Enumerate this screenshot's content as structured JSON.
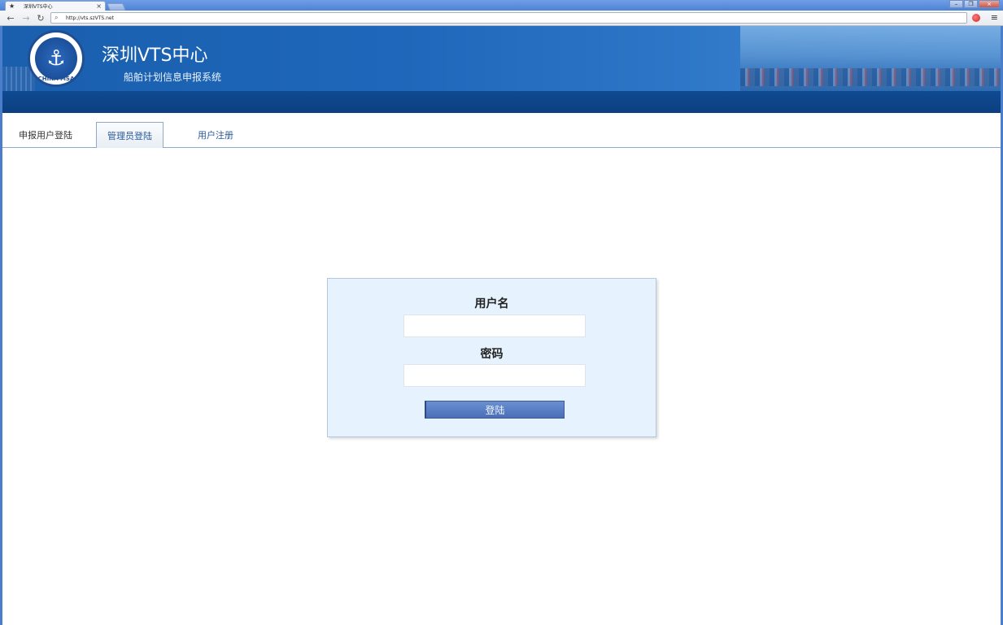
{
  "browser": {
    "tab_title": "深圳VTS中心",
    "tab_close": "×",
    "url": "http://vts.szVTS.net",
    "icons": {
      "star": "★",
      "back": "←",
      "forward": "→",
      "reload": "↻",
      "search": "⌕",
      "menu": "≡"
    },
    "window_controls": {
      "minimize": "–",
      "restore": "❐",
      "close": "×"
    }
  },
  "header": {
    "title": "深圳VTS中心",
    "subtitle": "船舶计划信息申报系统",
    "logo_text": "CHINA MSA",
    "logo_symbol": "⚓"
  },
  "nav": {
    "tabs": [
      {
        "label": "申报用户登陆",
        "active": false
      },
      {
        "label": "管理员登陆",
        "active": true
      },
      {
        "label": "用户注册",
        "active": false
      }
    ]
  },
  "login": {
    "username_label": "用户名",
    "username_value": "",
    "password_label": "密码",
    "password_value": "",
    "submit_label": "登陆"
  }
}
